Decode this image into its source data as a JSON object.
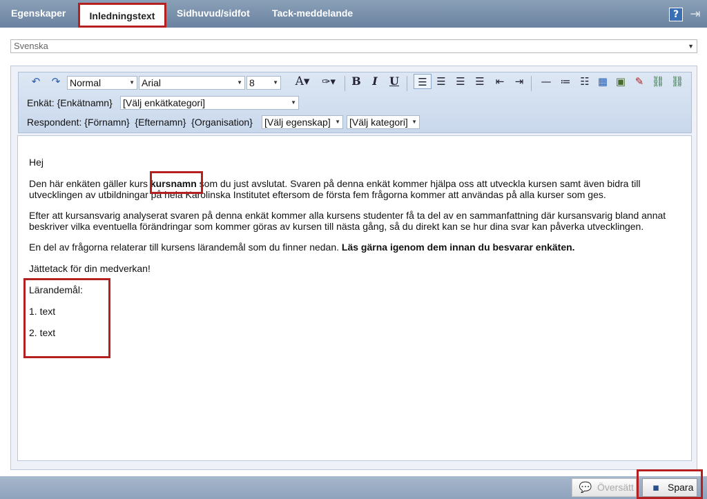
{
  "tabs": [
    {
      "label": "Egenskaper"
    },
    {
      "label": "Inledningstext"
    },
    {
      "label": "Sidhuvud/sidfot"
    },
    {
      "label": "Tack-meddelande"
    }
  ],
  "header": {
    "help_label": "?",
    "logout_glyph": "⇥"
  },
  "language": {
    "selected": "Svenska"
  },
  "toolbar": {
    "format": "Normal",
    "font": "Arial",
    "size": "8",
    "row2_label": "Enkät: {Enkätnamn}",
    "survey_category": "[Välj enkätkategori]",
    "row3_label": "Respondent: {Förnamn}  {Efternamn}  {Organisation}",
    "property_select": "[Välj egenskap]",
    "category_select": "[Välj kategori]"
  },
  "content": {
    "greeting": "Hej",
    "p1_a": "Den här enkäten gäller kurs ",
    "p1_bold": "kursnamn",
    "p1_b": " som du just avslutat. Svaren på denna enkät kommer hjälpa oss att utveckla kursen samt även bidra till utvecklingen av utbildningar på hela Karolinska Institutet eftersom de första fem frågorna kommer att användas på alla kurser som ges.",
    "p2": "Efter att kursansvarig analyserat svaren på denna enkät kommer alla kursens studenter få ta del av en sammanfattning där kursansvarig bland annat beskriver vilka eventuella förändringar som kommer göras av kursen till nästa gång, så du direkt kan se hur dina svar kan påverka utvecklingen.",
    "p3_a": "En del av frågorna relaterar till kursens lärandemål som du finner nedan. ",
    "p3_bold": "Läs gärna igenom dem innan du besvarar enkäten.",
    "p4": "Jättetack för din medverkan!",
    "objectives_label": "Lärandemål:",
    "item1": "1. text",
    "item2": "2. text"
  },
  "footer": {
    "translate_label": "Översätt",
    "save_label": "Spara"
  }
}
